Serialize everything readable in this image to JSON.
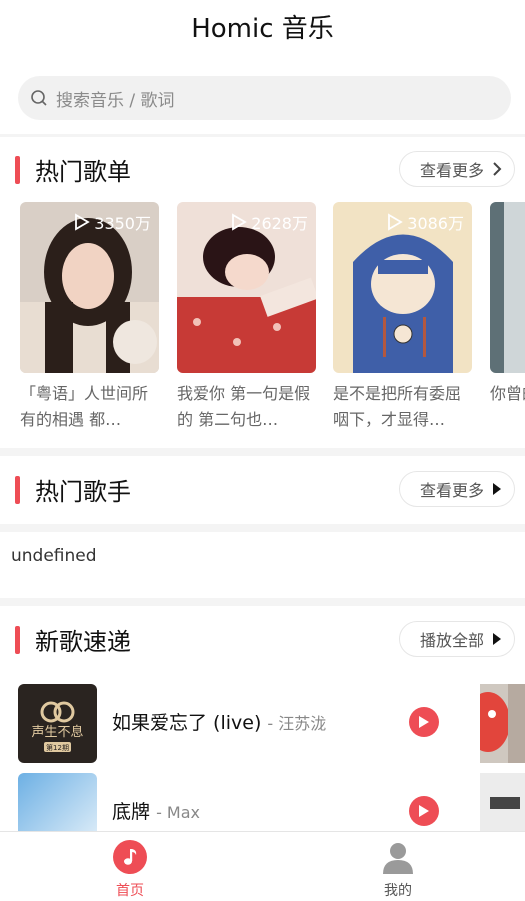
{
  "app": {
    "title": "Homic 音乐"
  },
  "search": {
    "placeholder": "搜索音乐 / 歌词"
  },
  "hot_playlists": {
    "title": "热门歌单",
    "more_label": "查看更多",
    "items": [
      {
        "play_count": "3350万",
        "name": "「粤语」人世间所有的相遇 都…"
      },
      {
        "play_count": "2628万",
        "name": "我爱你 第一句是假的 第二句也…"
      },
      {
        "play_count": "3086万",
        "name": "是不是把所有委屈咽下，才显得…"
      },
      {
        "play_count": "",
        "name": "你曾的喜"
      }
    ]
  },
  "hot_singers": {
    "title": "热门歌手",
    "more_label": "查看更多",
    "content": "undefined"
  },
  "new_songs": {
    "title": "新歌速递",
    "play_all_label": "播放全部",
    "items": [
      {
        "title": "如果爱忘了 (live)",
        "artist": "- 汪苏泷",
        "cover_text": "声生不息",
        "cover_sub": "第12期"
      },
      {
        "title": "底牌",
        "artist": "- Max",
        "cover_text": "",
        "cover_sub": ""
      }
    ]
  },
  "tabbar": {
    "items": [
      {
        "label": "首页",
        "active": true
      },
      {
        "label": "我的",
        "active": false
      }
    ]
  },
  "colors": {
    "accent": "#ee4d55",
    "inactive": "#9a9a9a"
  }
}
